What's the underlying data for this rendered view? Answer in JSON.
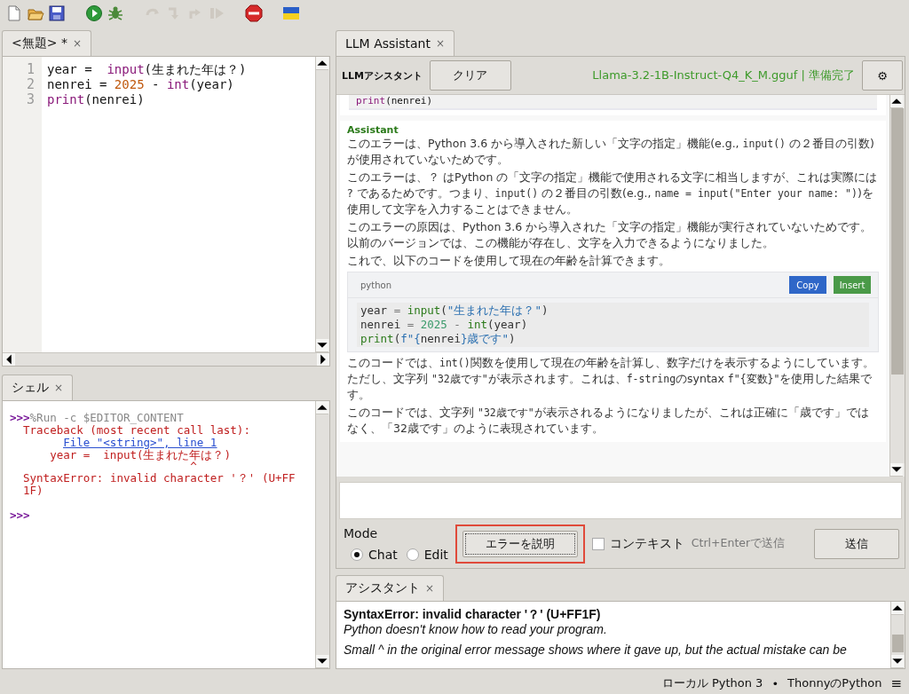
{
  "toolbar": [
    {
      "kind": "new",
      "disabled": false
    },
    {
      "kind": "open",
      "disabled": false
    },
    {
      "kind": "save",
      "disabled": false
    },
    {
      "kind": "run",
      "disabled": false
    },
    {
      "kind": "debug",
      "disabled": false
    },
    {
      "kind": "step-over",
      "disabled": true
    },
    {
      "kind": "step-into",
      "disabled": true
    },
    {
      "kind": "step-out",
      "disabled": true
    },
    {
      "kind": "resume",
      "disabled": true
    },
    {
      "kind": "stop",
      "disabled": false
    },
    {
      "kind": "flag",
      "disabled": false
    }
  ],
  "editor": {
    "tab": {
      "label": "<無題> *",
      "close": "×"
    },
    "lines": [
      {
        "number": "1",
        "tokens": [
          {
            "kind": "plain",
            "text": "year =  "
          },
          {
            "kind": "builtin",
            "text": "input"
          },
          {
            "kind": "plain",
            "text": "(生まれた年は？)"
          }
        ]
      },
      {
        "number": "2",
        "tokens": [
          {
            "kind": "plain",
            "text": "nenrei = "
          },
          {
            "kind": "number",
            "text": "2025"
          },
          {
            "kind": "plain",
            "text": " - "
          },
          {
            "kind": "builtin",
            "text": "int"
          },
          {
            "kind": "plain",
            "text": "(year)"
          }
        ]
      },
      {
        "number": "3",
        "tokens": [
          {
            "kind": "builtin",
            "text": "print"
          },
          {
            "kind": "plain",
            "text": "(nenrei)"
          }
        ]
      }
    ]
  },
  "shell": {
    "tab": {
      "label": "シェル",
      "close": "×"
    },
    "lines": [
      {
        "kind": "command",
        "prompt": ">>>",
        "text": "%Run -c $EDITOR_CONTENT"
      },
      {
        "kind": "error",
        "text": "Traceback (most recent call last):"
      },
      {
        "kind": "link",
        "text": "File \"<string>\", line 1"
      },
      {
        "kind": "source",
        "text": "year =  input(生まれた年は？)"
      },
      {
        "kind": "caret",
        "text": "^"
      },
      {
        "kind": "error",
        "text": "SyntaxError: invalid character '？' (U+FF"
      },
      {
        "kind": "error",
        "text": "1F)"
      },
      {
        "kind": "blank"
      },
      {
        "kind": "command",
        "prompt": ">>>"
      }
    ]
  },
  "llm": {
    "tab": {
      "label": "LLM Assistant",
      "close": "×"
    },
    "title": "LLMアシスタント",
    "clear_button": "クリア",
    "status": "Llama-3.2-1B-Instruct-Q4_K_M.gguf | 準備完了",
    "settings_button": "⚙",
    "previous_code": [
      {
        "kind": "builtin",
        "text": "print"
      },
      {
        "kind": "plain",
        "text": "(nenrei)"
      }
    ],
    "message": {
      "role": "Assistant",
      "blocks": [
        {
          "kind": "paragraph",
          "segments": [
            {
              "code": false,
              "text": "このエラーは、Python 3.6 から導入された新しい「文字の指定」機能(e.g., "
            },
            {
              "code": true,
              "text": "input()"
            },
            {
              "code": false,
              "text": " の２番目の引数) が使用されていないためです。"
            }
          ]
        },
        {
          "kind": "paragraph",
          "segments": [
            {
              "code": false,
              "text": "このエラーは、？ はPython の「文字の指定」機能で使用される文字に相当しますが、これは実際には ? であるためです。つまり、"
            },
            {
              "code": true,
              "text": "input()"
            },
            {
              "code": false,
              "text": " の２番目の引数(e.g., "
            },
            {
              "code": true,
              "text": "name = input(\"Enter your name: \")"
            },
            {
              "code": false,
              "text": ")を使用して文字を入力することはできません。"
            }
          ]
        },
        {
          "kind": "paragraph",
          "segments": [
            {
              "code": false,
              "text": "このエラーの原因は、Python 3.6 から導入された「文字の指定」機能が実行されていないためです。以前のバージョンでは、この機能が存在し、文字を入力できるようになりました。"
            }
          ]
        },
        {
          "kind": "paragraph",
          "segments": [
            {
              "code": false,
              "text": "これで、以下のコードを使用して現在の年齢を計算できます。"
            }
          ]
        },
        {
          "kind": "code",
          "language": "python",
          "copy_button": "Copy",
          "insert_button": "Insert",
          "lines": [
            [
              {
                "kind": "plain",
                "text": "year"
              },
              {
                "kind": "op",
                "text": " = "
              },
              {
                "kind": "builtin",
                "text": "input"
              },
              {
                "kind": "plain",
                "text": "("
              },
              {
                "kind": "string",
                "text": "\"生まれた年は？\""
              },
              {
                "kind": "plain",
                "text": ")"
              }
            ],
            [
              {
                "kind": "plain",
                "text": "nenrei"
              },
              {
                "kind": "op",
                "text": " = "
              },
              {
                "kind": "number",
                "text": "2025"
              },
              {
                "kind": "op",
                "text": " - "
              },
              {
                "kind": "builtin",
                "text": "int"
              },
              {
                "kind": "plain",
                "text": "(year)"
              }
            ],
            [
              {
                "kind": "builtin",
                "text": "print"
              },
              {
                "kind": "plain",
                "text": "("
              },
              {
                "kind": "string",
                "text": "f\"{"
              },
              {
                "kind": "plain",
                "text": "nenrei"
              },
              {
                "kind": "string",
                "text": "}歳です\""
              },
              {
                "kind": "plain",
                "text": ")"
              }
            ]
          ]
        },
        {
          "kind": "paragraph",
          "segments": [
            {
              "code": false,
              "text": "このコードでは、"
            },
            {
              "code": true,
              "text": "int()"
            },
            {
              "code": false,
              "text": "関数を使用して現在の年齢を計算し、数字だけを表示するようにしています。ただし、文字列 "
            },
            {
              "code": true,
              "text": "\"32歳です\""
            },
            {
              "code": false,
              "text": "が表示されます。これは、"
            },
            {
              "code": true,
              "text": "f-string"
            },
            {
              "code": false,
              "text": "のsyntax "
            },
            {
              "code": true,
              "text": "f\"{変数}\""
            },
            {
              "code": false,
              "text": "を使用した結果です。"
            }
          ]
        },
        {
          "kind": "paragraph",
          "segments": [
            {
              "code": false,
              "text": "このコードでは、文字列 "
            },
            {
              "code": true,
              "text": "\"32歳です\""
            },
            {
              "code": false,
              "text": "が表示されるようになりましたが、これは正確に「歳です」ではなく、「32歳です」のように表現されています。"
            }
          ]
        }
      ]
    },
    "mode_label": "Mode",
    "modes": [
      {
        "label": "Chat",
        "selected": true
      },
      {
        "label": "Edit",
        "selected": false
      }
    ],
    "explain_button": {
      "label": "エラーを説明",
      "highlighted": true
    },
    "context": {
      "label": "コンテキスト",
      "checked": false
    },
    "hint": "Ctrl+Enterで送信",
    "send_button": "送信"
  },
  "assistant": {
    "tab": {
      "label": "アシスタント",
      "close": "×"
    },
    "lines": [
      {
        "kind": "title",
        "text": "SyntaxError: invalid character '？' (U+FF1F)"
      },
      {
        "kind": "subtitle",
        "text": "Python doesn't know how to read your program."
      },
      {
        "kind": "body",
        "text": "Small ^ in the original error message shows where it gave up, but the actual mistake can be"
      }
    ]
  },
  "status_bar": {
    "interpreter": "ローカル Python 3",
    "separator": "•",
    "name": "ThonnyのPython",
    "menu": "≡"
  }
}
